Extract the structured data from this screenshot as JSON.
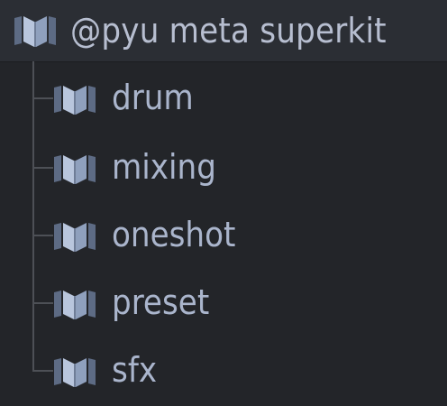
{
  "theme": {
    "background": "#232529",
    "root_row_background": "#2b2e34",
    "tree_line_color": "#4d5056",
    "text_color": "#aab5cc",
    "icon_light": "#b9c6dd",
    "icon_mid": "#8fa0bd",
    "icon_dark": "#5d6b84"
  },
  "root": {
    "label": "@pyu meta superkit",
    "icon": "open-folder-icon"
  },
  "children": [
    {
      "label": "drum",
      "icon": "open-folder-icon"
    },
    {
      "label": "mixing",
      "icon": "open-folder-icon"
    },
    {
      "label": "oneshot",
      "icon": "open-folder-icon"
    },
    {
      "label": "preset",
      "icon": "open-folder-icon"
    },
    {
      "label": "sfx",
      "icon": "open-folder-icon"
    }
  ]
}
